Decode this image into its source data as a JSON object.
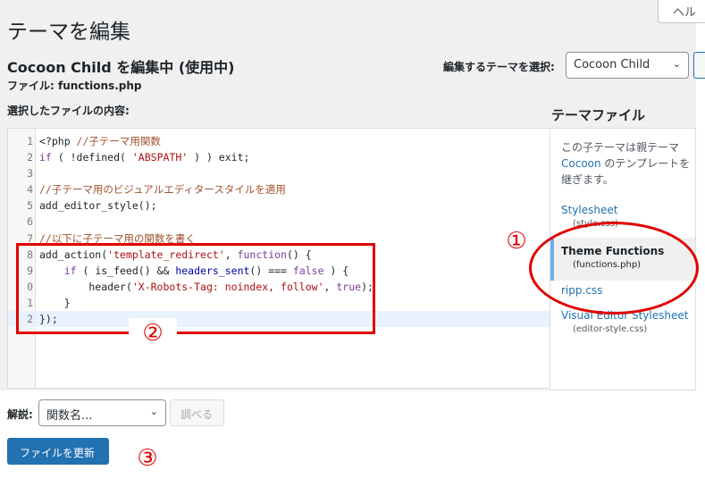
{
  "page": {
    "title": "テーマを編集",
    "help_tab": "ヘル",
    "editing_title": "Cocoon Child を編集中 (使用中)",
    "file_label": "ファイル:",
    "file_name": "functions.php",
    "select_theme_label": "編集するテーマを選択:",
    "selected_theme": "Cocoon Child",
    "content_label": "選択したファイルの内容:"
  },
  "editor": {
    "lines": [
      {
        "ln": "1",
        "parts": [
          {
            "t": "<?php ",
            "c": "fn"
          },
          {
            "t": "//子テーマ用関数",
            "c": "cm"
          }
        ]
      },
      {
        "ln": "2",
        "parts": [
          {
            "t": "if",
            "c": "kw"
          },
          {
            "t": " ( !defined( ",
            "c": "fn"
          },
          {
            "t": "'ABSPATH'",
            "c": "st"
          },
          {
            "t": " ) ) exit;",
            "c": "fn"
          }
        ]
      },
      {
        "ln": "3",
        "parts": []
      },
      {
        "ln": "4",
        "parts": [
          {
            "t": "//子テーマ用のビジュアルエディタースタイルを適用",
            "c": "cm"
          }
        ]
      },
      {
        "ln": "5",
        "parts": [
          {
            "t": "add_editor_style();",
            "c": "fn"
          }
        ]
      },
      {
        "ln": "6",
        "parts": []
      },
      {
        "ln": "7",
        "parts": [
          {
            "t": "//以下に子テーマ用の関数を書く",
            "c": "cm"
          }
        ]
      },
      {
        "ln": "8",
        "parts": [
          {
            "t": "add_action(",
            "c": "fn"
          },
          {
            "t": "'template_redirect'",
            "c": "st"
          },
          {
            "t": ", ",
            "c": "fn"
          },
          {
            "t": "function",
            "c": "kw"
          },
          {
            "t": "() {",
            "c": "fn"
          }
        ]
      },
      {
        "ln": "9",
        "parts": [
          {
            "t": "    if",
            "c": "kw"
          },
          {
            "t": " ( is_feed() && ",
            "c": "fn"
          },
          {
            "t": "headers_sent",
            "c": "bl"
          },
          {
            "t": "() === ",
            "c": "fn"
          },
          {
            "t": "false",
            "c": "kw"
          },
          {
            "t": " ) {",
            "c": "fn"
          }
        ]
      },
      {
        "ln": "0",
        "parts": [
          {
            "t": "        header(",
            "c": "fn"
          },
          {
            "t": "'X-Robots-Tag: noindex, follow'",
            "c": "st"
          },
          {
            "t": ", ",
            "c": "fn"
          },
          {
            "t": "true",
            "c": "kw"
          },
          {
            "t": ");",
            "c": "fn"
          }
        ]
      },
      {
        "ln": "1",
        "parts": [
          {
            "t": "    }",
            "c": "fn"
          }
        ]
      },
      {
        "ln": "2",
        "parts": [
          {
            "t": "});",
            "c": "fn"
          }
        ],
        "active": true
      }
    ]
  },
  "file_panel": {
    "title": "テーマファイル",
    "desc_before": "この子テーマは親テーマ ",
    "desc_link": "Cocoon",
    "desc_after": " のテンプレートを継ぎます。",
    "files": [
      {
        "name": "Stylesheet",
        "sub": "(style.css)"
      },
      {
        "name": "Theme Functions",
        "sub": "(functions.php)"
      },
      {
        "name": "",
        "sub": "...."
      },
      {
        "name": "Visual Editor Stylesheet",
        "sub": "(editor-style.css)"
      }
    ],
    "partial_item": "ripp.css"
  },
  "bottom": {
    "doc_label": "解説:",
    "doc_select_value": "関数名...",
    "lookup_button": "調べる",
    "update_button": "ファイルを更新"
  },
  "annotations": {
    "marker_1": "①",
    "marker_2": "②",
    "marker_3": "③",
    "accent_color": "#e00000"
  }
}
